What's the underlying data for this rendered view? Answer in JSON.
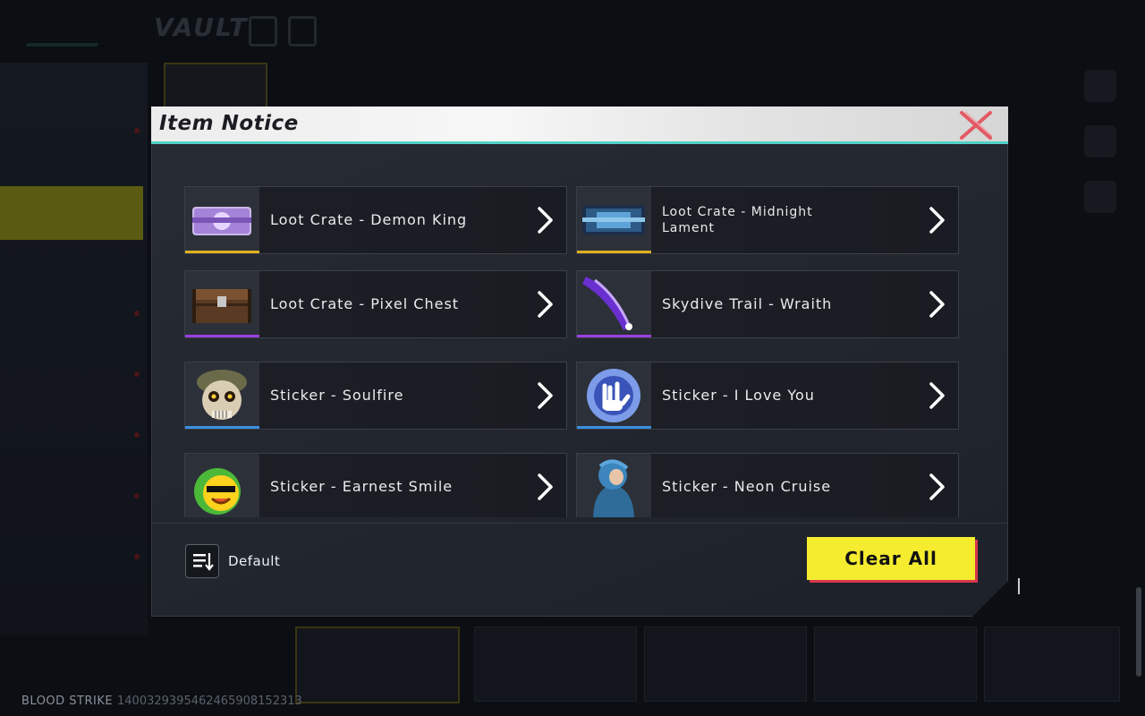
{
  "background": {
    "title": "VAULT",
    "footer_brand": "BLOOD STRIKE",
    "footer_id": "1400329395462465908152313"
  },
  "modal": {
    "title": "Item Notice",
    "items": [
      {
        "label": "Loot Crate - Demon King",
        "rarity_color": "#e0b020",
        "thumb": "crate-purple-icon"
      },
      {
        "label": "Loot Crate - Midnight Lament",
        "rarity_color": "#e0b020",
        "thumb": "crate-blue-icon"
      },
      {
        "label": "Loot Crate - Pixel Chest",
        "rarity_color": "#9b3fe0",
        "thumb": "chest-icon"
      },
      {
        "label": "Skydive Trail - Wraith",
        "rarity_color": "#9b3fe0",
        "thumb": "trail-icon"
      },
      {
        "label": "Sticker - Soulfire",
        "rarity_color": "#3a8ee0",
        "thumb": "skull-sticker-icon"
      },
      {
        "label": "Sticker - I Love You",
        "rarity_color": "#3a8ee0",
        "thumb": "hand-sticker-icon"
      },
      {
        "label": "Sticker - Earnest Smile",
        "rarity_color": "#3a8ee0",
        "thumb": "smile-sticker-icon"
      },
      {
        "label": "Sticker - Neon Cruise",
        "rarity_color": "#3a8ee0",
        "thumb": "hood-sticker-icon"
      }
    ],
    "sort_label": "Default",
    "clear_all_label": "Clear All"
  }
}
